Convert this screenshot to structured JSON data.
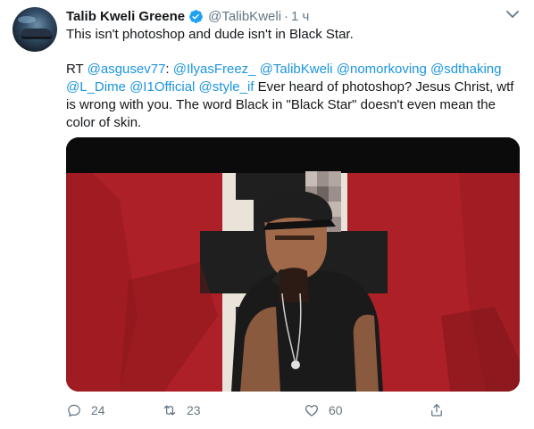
{
  "tweet": {
    "author_name": "Talib Kweli Greene",
    "handle": "@TalibKweli",
    "separator": "·",
    "time": "1 ч",
    "verified_icon": "verified-badge-icon",
    "line1": "This isn't photoshop and dude isn't in Black Star.",
    "quote": {
      "rt_prefix": "RT ",
      "mention_1": "@asgusev77",
      "colon": ": ",
      "mentions_a": "@IlyasFreez_ @TalibKweli @nomorkoving @sdthaking",
      "mentions_b": "@L_Dime @I1Official @style_if",
      "text_b": " Ever heard of photoshop? Jesus Christ, wtf",
      "line_c": "is wrong with you. The word Black in \"Black Star\" doesn't even mean the",
      "line_d": "color of skin."
    },
    "media_alt": "photo",
    "actions": {
      "reply_count": "24",
      "retweet_count": "23",
      "like_count": "60"
    }
  },
  "colors": {
    "text": "#14171a",
    "secondary": "#657786",
    "link": "#1b95e0",
    "verified": "#1da1f2",
    "flag_red": "#b8222a"
  }
}
